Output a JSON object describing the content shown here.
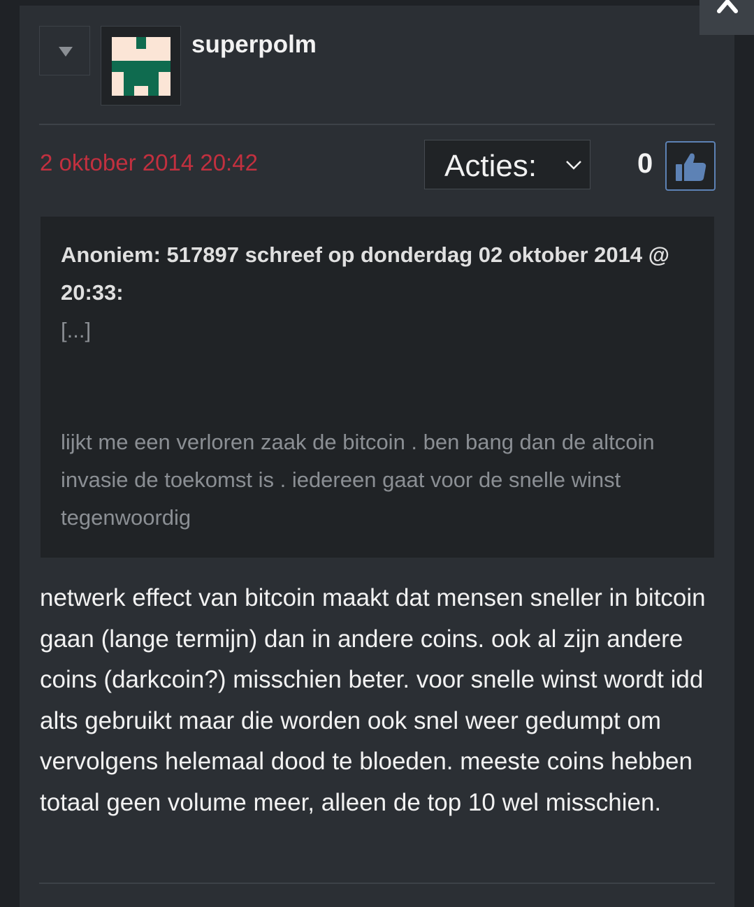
{
  "post": {
    "username": "superpolm",
    "date": "2 oktober 2014 20:42",
    "actions_label": "Acties:",
    "like_count": "0",
    "quote": {
      "header": "Anoniem: 517897 schreef op donderdag 02 oktober 2014 @ 20:33:",
      "ellipsis": "[...]",
      "text": "lijkt me een verloren zaak de bitcoin . ben bang dan de altcoin invasie de toekomst is . iedereen gaat voor de snelle winst tegenwoordig"
    },
    "body": "netwerk effect van bitcoin maakt dat mensen sneller in bitcoin gaan (lange termijn) dan in andere coins. ook al zijn andere coins (darkcoin?) misschien beter. voor snelle winst wordt idd alts gebruikt maar die worden ook snel weer gedumpt om vervolgens helemaal dood te bloeden. meeste coins hebben totaal geen volume meer, alleen de top 10 wel misschien."
  },
  "colors": {
    "background": "#1f2226",
    "card": "#2b2f34",
    "quote_bg": "#202326",
    "date": "#c2303f",
    "like_accent": "#5d82b5",
    "avatar_green": "#0f6b4f",
    "avatar_cream": "#fbe5d6"
  },
  "icons": {
    "scroll": "chevron-up-icon",
    "collapse": "triangle-down-icon",
    "actions": "chevron-down-icon",
    "like": "thumbs-up-icon"
  }
}
